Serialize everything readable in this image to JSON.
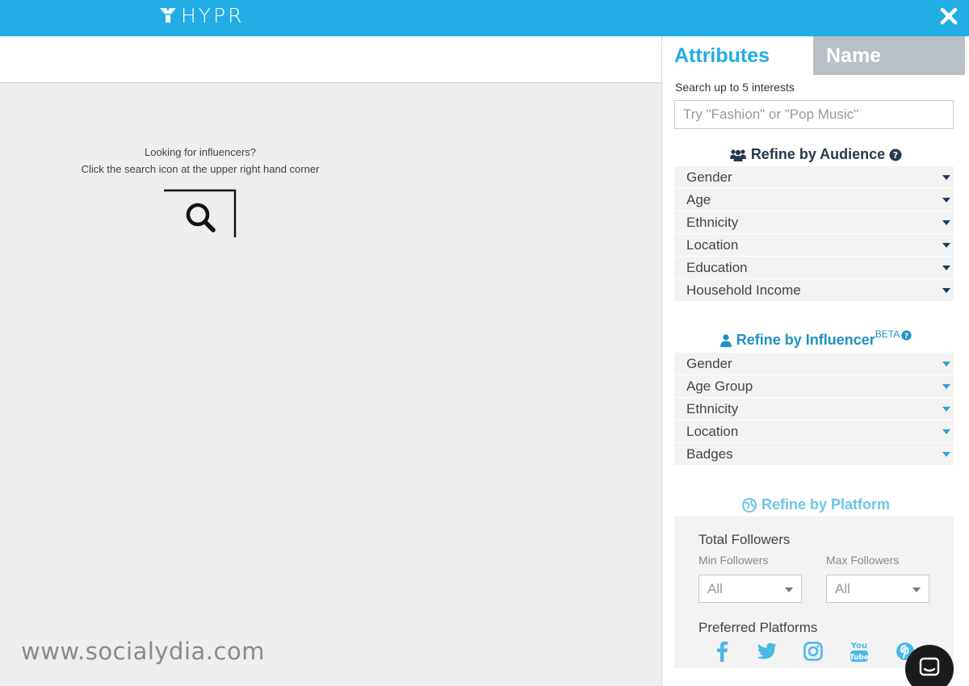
{
  "header": {
    "logo_text": "HYPR",
    "bar_color": "#22ade5",
    "close_icon": "close-icon"
  },
  "main": {
    "hint_line1": "Looking for influencers?",
    "hint_line2": "Click the search icon at the upper right hand corner",
    "search_icon": "search-icon",
    "watermark": "www.socialydia.com"
  },
  "panel": {
    "tabs": [
      {
        "label": "Attributes",
        "active": true
      },
      {
        "label": "Name",
        "active": false
      }
    ],
    "search": {
      "label": "Search up to 5 interests",
      "placeholder": "Try \"Fashion\" or \"Pop Music\""
    },
    "audience": {
      "title": "Refine by Audience",
      "icon": "users-icon",
      "items": [
        "Gender",
        "Age",
        "Ethnicity",
        "Location",
        "Education",
        "Household Income"
      ]
    },
    "influencer": {
      "title": "Refine by Influencer",
      "badge": "BETA",
      "icon": "user-icon",
      "items": [
        "Gender",
        "Age Group",
        "Ethnicity",
        "Location",
        "Badges"
      ]
    },
    "platform": {
      "title": "Refine by Platform",
      "icon": "globe-icon",
      "total_followers_label": "Total Followers",
      "min_label": "Min Followers",
      "max_label": "Max Followers",
      "min_value": "All",
      "max_value": "All",
      "preferred_label": "Preferred Platforms",
      "platforms": [
        "facebook",
        "twitter",
        "instagram",
        "youtube",
        "pinterest"
      ]
    }
  },
  "colors": {
    "accent": "#22ade5",
    "audience_title": "#263a4c",
    "influencer_title": "#1d92c4",
    "platform_title": "#6bc6ea",
    "platform_icons": "#4bb8e6"
  }
}
